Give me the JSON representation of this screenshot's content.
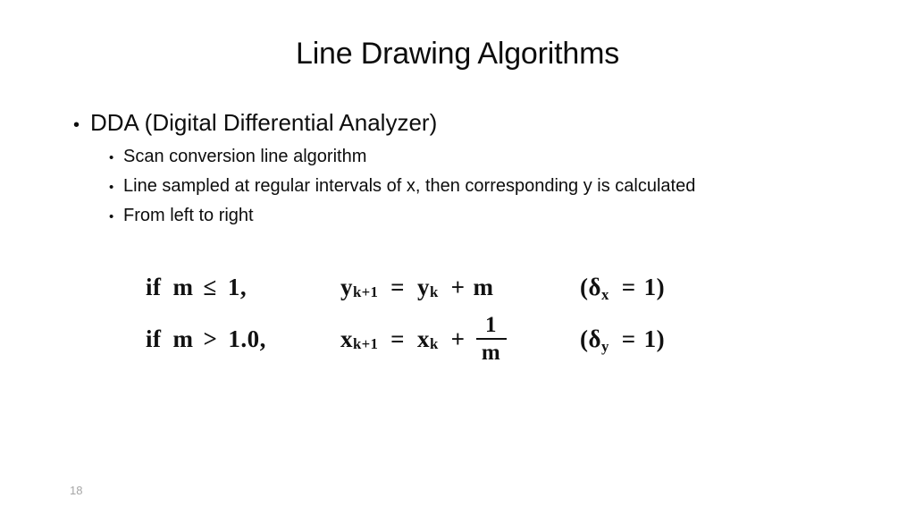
{
  "slide": {
    "title": "Line Drawing Algorithms",
    "page_number": "18",
    "background_color": "#ffffff",
    "text_color": "#0d0d0d",
    "page_number_color": "#a6a6a6"
  },
  "bullets": {
    "level1": [
      {
        "bullet_glyph": "•",
        "text": "DDA (Digital Differential Analyzer)"
      }
    ],
    "level2": [
      {
        "bullet_glyph": "•",
        "text": "Scan conversion line algorithm"
      },
      {
        "bullet_glyph": "•",
        "text": "Line sampled at regular intervals of x, then corresponding y is calculated"
      },
      {
        "bullet_glyph": "•",
        "text": "From left to right"
      }
    ]
  },
  "equations": {
    "row1": {
      "condition": {
        "keyword": "if",
        "variable": "m",
        "relation": "≤",
        "value": "1,"
      },
      "formula": {
        "lhs_base": "y",
        "lhs_sub": "k+1",
        "equals": "=",
        "rhs_base": "y",
        "rhs_sub": "k",
        "plus": "+",
        "term": "m"
      },
      "note": {
        "open": "(",
        "symbol": "δ",
        "sub": "x",
        "equals": "=",
        "value": "1",
        "close": ")"
      },
      "plain_text": "if m ≤ 1,    yₖ₊₁ = yₖ + m    (δₓ = 1)"
    },
    "row2": {
      "condition": {
        "keyword": "if",
        "variable": "m",
        "relation": ">",
        "value": "1.0,"
      },
      "formula": {
        "lhs_base": "x",
        "lhs_sub": "k+1",
        "equals": "=",
        "rhs_base": "x",
        "rhs_sub": "k",
        "plus": "+",
        "fraction_numerator": "1",
        "fraction_denominator": "m"
      },
      "note": {
        "open": "(",
        "symbol": "δ",
        "sub": "y",
        "equals": "=",
        "value": "1",
        "close": ")"
      },
      "plain_text": "if m > 1.0,    xₖ₊₁ = xₖ + 1/m    (δᵧ = 1)"
    }
  }
}
